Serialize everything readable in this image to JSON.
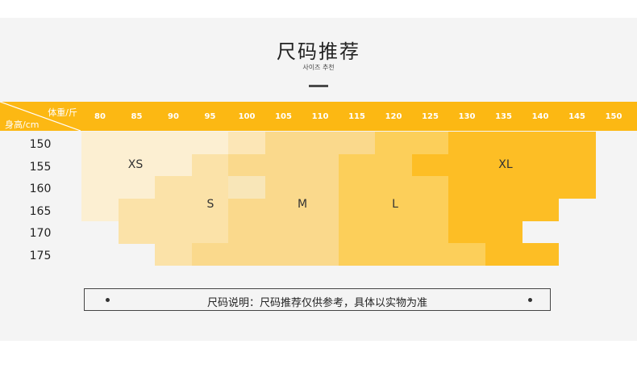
{
  "title": "尺码推荐",
  "subtitle": "사이즈 추천",
  "corner": {
    "weight_label": "体重/斤",
    "height_label": "身高/cm"
  },
  "weights": [
    "80",
    "85",
    "90",
    "95",
    "100",
    "105",
    "110",
    "115",
    "120",
    "125",
    "130",
    "135",
    "140",
    "145",
    "150"
  ],
  "heights": [
    "150",
    "155",
    "160",
    "165",
    "170",
    "175"
  ],
  "chart_data": {
    "type": "heatmap",
    "x_label": "体重/斤",
    "y_label": "身高/cm",
    "x": [
      80,
      85,
      90,
      95,
      100,
      105,
      110,
      115,
      120,
      125,
      130,
      135,
      140,
      145,
      150
    ],
    "y": [
      150,
      155,
      160,
      165,
      170,
      175
    ],
    "sizes": [
      {
        "name": "XS",
        "color": "#fcefd2"
      },
      {
        "name": "S",
        "color": "#fbe2a8"
      },
      {
        "name": "M",
        "color": "#fad98c"
      },
      {
        "name": "L",
        "color": "#fccf5a"
      },
      {
        "name": "XL",
        "color": "#fdbe25"
      }
    ],
    "extra_colors": {
      "mid": "#fce6b6",
      "light": "#f8e6b8"
    },
    "grid": [
      [
        "XS",
        "XS",
        "XS",
        "XS",
        "mid",
        "M",
        "M",
        "M",
        "L",
        "L",
        "XL",
        "XL",
        "XL",
        "XL",
        null
      ],
      [
        "XS",
        "XS",
        "XS",
        "S",
        "M",
        "M",
        "M",
        "L",
        "L",
        "XL",
        "XL",
        "XL",
        "XL",
        "XL",
        null
      ],
      [
        "XS",
        "XS",
        "S",
        "S",
        "light",
        "M",
        "M",
        "L",
        "L",
        "L",
        "XL",
        "XL",
        "XL",
        "XL",
        null
      ],
      [
        "XS",
        "S",
        "S",
        "S",
        "M",
        "M",
        "M",
        "L",
        "L",
        "L",
        "XL",
        "XL",
        "XL",
        null,
        null
      ],
      [
        null,
        "S",
        "S",
        "S",
        "M",
        "M",
        "M",
        "L",
        "L",
        "L",
        "XL",
        "XL",
        null,
        null,
        null
      ],
      [
        null,
        null,
        "S",
        "M",
        "M",
        "M",
        "M",
        "L",
        "L",
        "L",
        "L",
        "XL",
        "XL",
        null,
        null
      ]
    ]
  },
  "note": "尺码说明：尺码推荐仅供参考，具体以实物为准"
}
